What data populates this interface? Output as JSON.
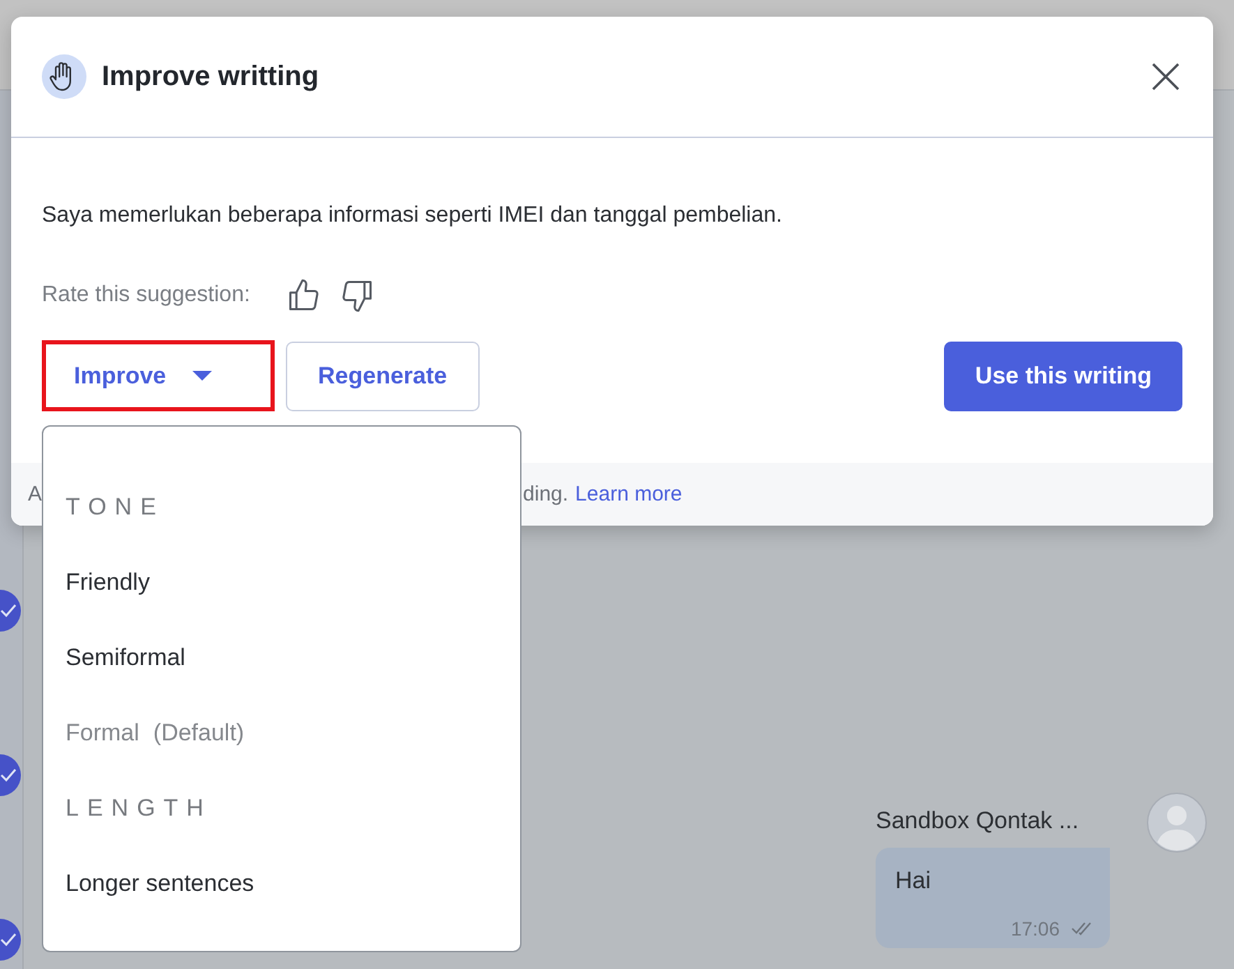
{
  "background": {
    "chat": {
      "sender": "Sandbox Qontak ...",
      "message": "Hai",
      "time": "17:06"
    }
  },
  "dialog": {
    "title": "Improve writting",
    "suggestion": "Saya memerlukan beberapa informasi seperti IMEI dan tanggal pembelian.",
    "rating_label": "Rate this suggestion:",
    "buttons": [
      {
        "kind": "dropdown",
        "label": "Improve",
        "highlighted": true
      },
      {
        "kind": "secondary",
        "label": "Regenerate"
      },
      {
        "kind": "primary",
        "label": "Use this writing"
      }
    ],
    "footer": {
      "text_start": "A",
      "text_end": "ding.",
      "link": "Learn more"
    }
  },
  "menu": {
    "items": [
      {
        "kind": "header",
        "label": "TONE"
      },
      {
        "kind": "option",
        "label": "Friendly",
        "selected": false
      },
      {
        "kind": "option",
        "label": "Semiformal",
        "selected": false
      },
      {
        "kind": "option",
        "label": "Formal",
        "note": "(Default)",
        "selected": true
      },
      {
        "kind": "header",
        "label": "LENGTH"
      },
      {
        "kind": "option",
        "label": "Longer sentences",
        "selected": false
      }
    ]
  }
}
